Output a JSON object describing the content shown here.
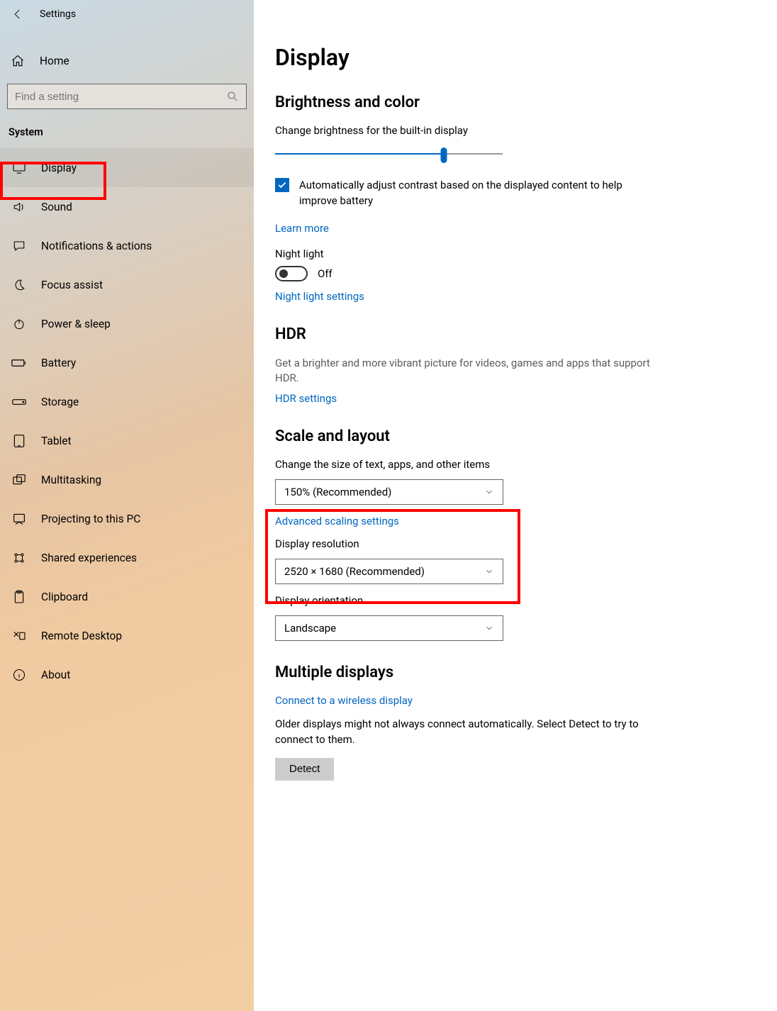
{
  "header": {
    "title": "Settings",
    "home_label": "Home"
  },
  "search": {
    "placeholder": "Find a setting"
  },
  "sidebar": {
    "group": "System",
    "items": [
      {
        "label": "Display"
      },
      {
        "label": "Sound"
      },
      {
        "label": "Notifications & actions"
      },
      {
        "label": "Focus assist"
      },
      {
        "label": "Power & sleep"
      },
      {
        "label": "Battery"
      },
      {
        "label": "Storage"
      },
      {
        "label": "Tablet"
      },
      {
        "label": "Multitasking"
      },
      {
        "label": "Projecting to this PC"
      },
      {
        "label": "Shared experiences"
      },
      {
        "label": "Clipboard"
      },
      {
        "label": "Remote Desktop"
      },
      {
        "label": "About"
      }
    ]
  },
  "page": {
    "title": "Display",
    "brightness": {
      "section": "Brightness and color",
      "label": "Change brightness for the built-in display",
      "slider_percent": 74,
      "checkbox_text": "Automatically adjust contrast based on the displayed content to help improve battery",
      "learn_more": "Learn more",
      "night_light_label": "Night light",
      "night_light_value": "Off",
      "night_light_link": "Night light settings"
    },
    "hdr": {
      "section": "HDR",
      "desc": "Get a brighter and more vibrant picture for videos, games and apps that support HDR.",
      "link": "HDR settings"
    },
    "scale": {
      "section": "Scale and layout",
      "size_label": "Change the size of text, apps, and other items",
      "size_value": "150% (Recommended)",
      "adv_link": "Advanced scaling settings",
      "res_label": "Display resolution",
      "res_value": "2520 × 1680 (Recommended)",
      "orient_label": "Display orientation",
      "orient_value": "Landscape"
    },
    "multi": {
      "section": "Multiple displays",
      "connect_link": "Connect to a wireless display",
      "desc": "Older displays might not always connect automatically. Select Detect to try to connect to them.",
      "detect": "Detect"
    }
  }
}
